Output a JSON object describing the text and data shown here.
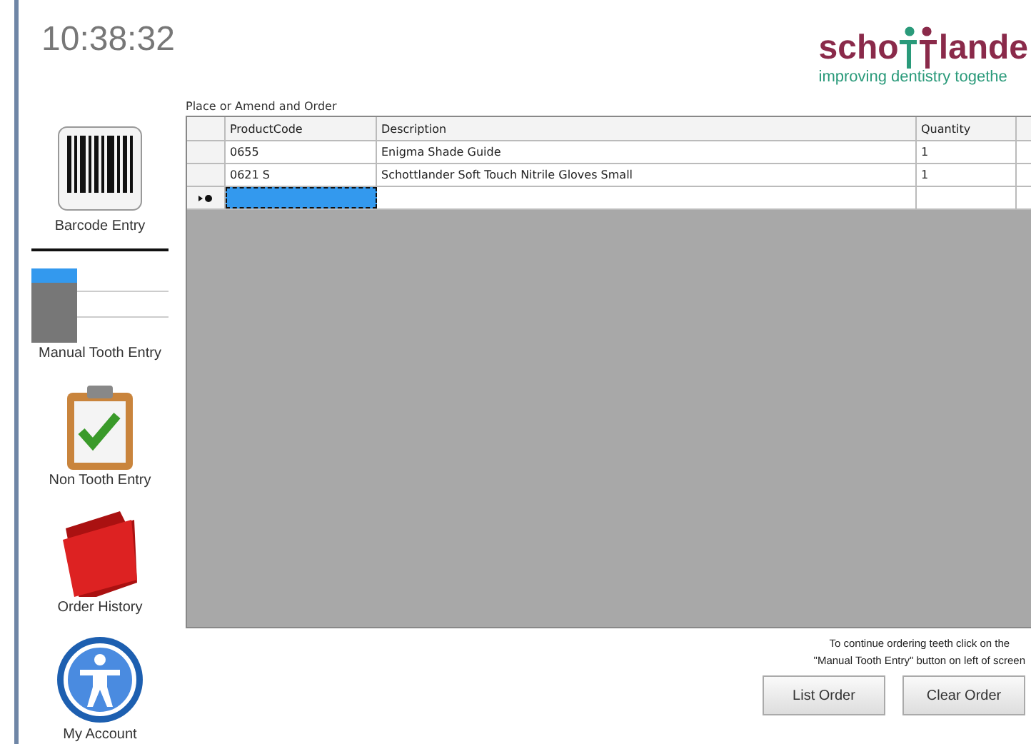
{
  "clock": "10:38:32",
  "logo": {
    "word_start": "scho",
    "word_end": "lande",
    "tagline": "improving dentistry togethe"
  },
  "sidebar": {
    "items": [
      {
        "kind": "barcode",
        "label": "Barcode Entry"
      },
      {
        "kind": "tooth",
        "label": "Manual Tooth Entry"
      },
      {
        "kind": "clipboard",
        "label": "Non Tooth Entry"
      },
      {
        "kind": "folder",
        "label": "Order History"
      },
      {
        "kind": "account",
        "label": "My Account"
      }
    ]
  },
  "order": {
    "title": "Place or Amend and Order",
    "columns": [
      "ProductCode",
      "Description",
      "Quantity"
    ],
    "rows": [
      {
        "cells": [
          "0655",
          "Enigma Shade Guide",
          "1"
        ]
      },
      {
        "cells": [
          "0621 S",
          "Schottlander Soft Touch Nitrile Gloves Small",
          "1"
        ]
      }
    ],
    "new_row": {
      "selected": true
    }
  },
  "note": [
    "To continue ordering teeth click on the",
    "\"Manual Tooth Entry\" button on left of screen"
  ],
  "buttons": [
    "List Order",
    "Clear Order"
  ]
}
